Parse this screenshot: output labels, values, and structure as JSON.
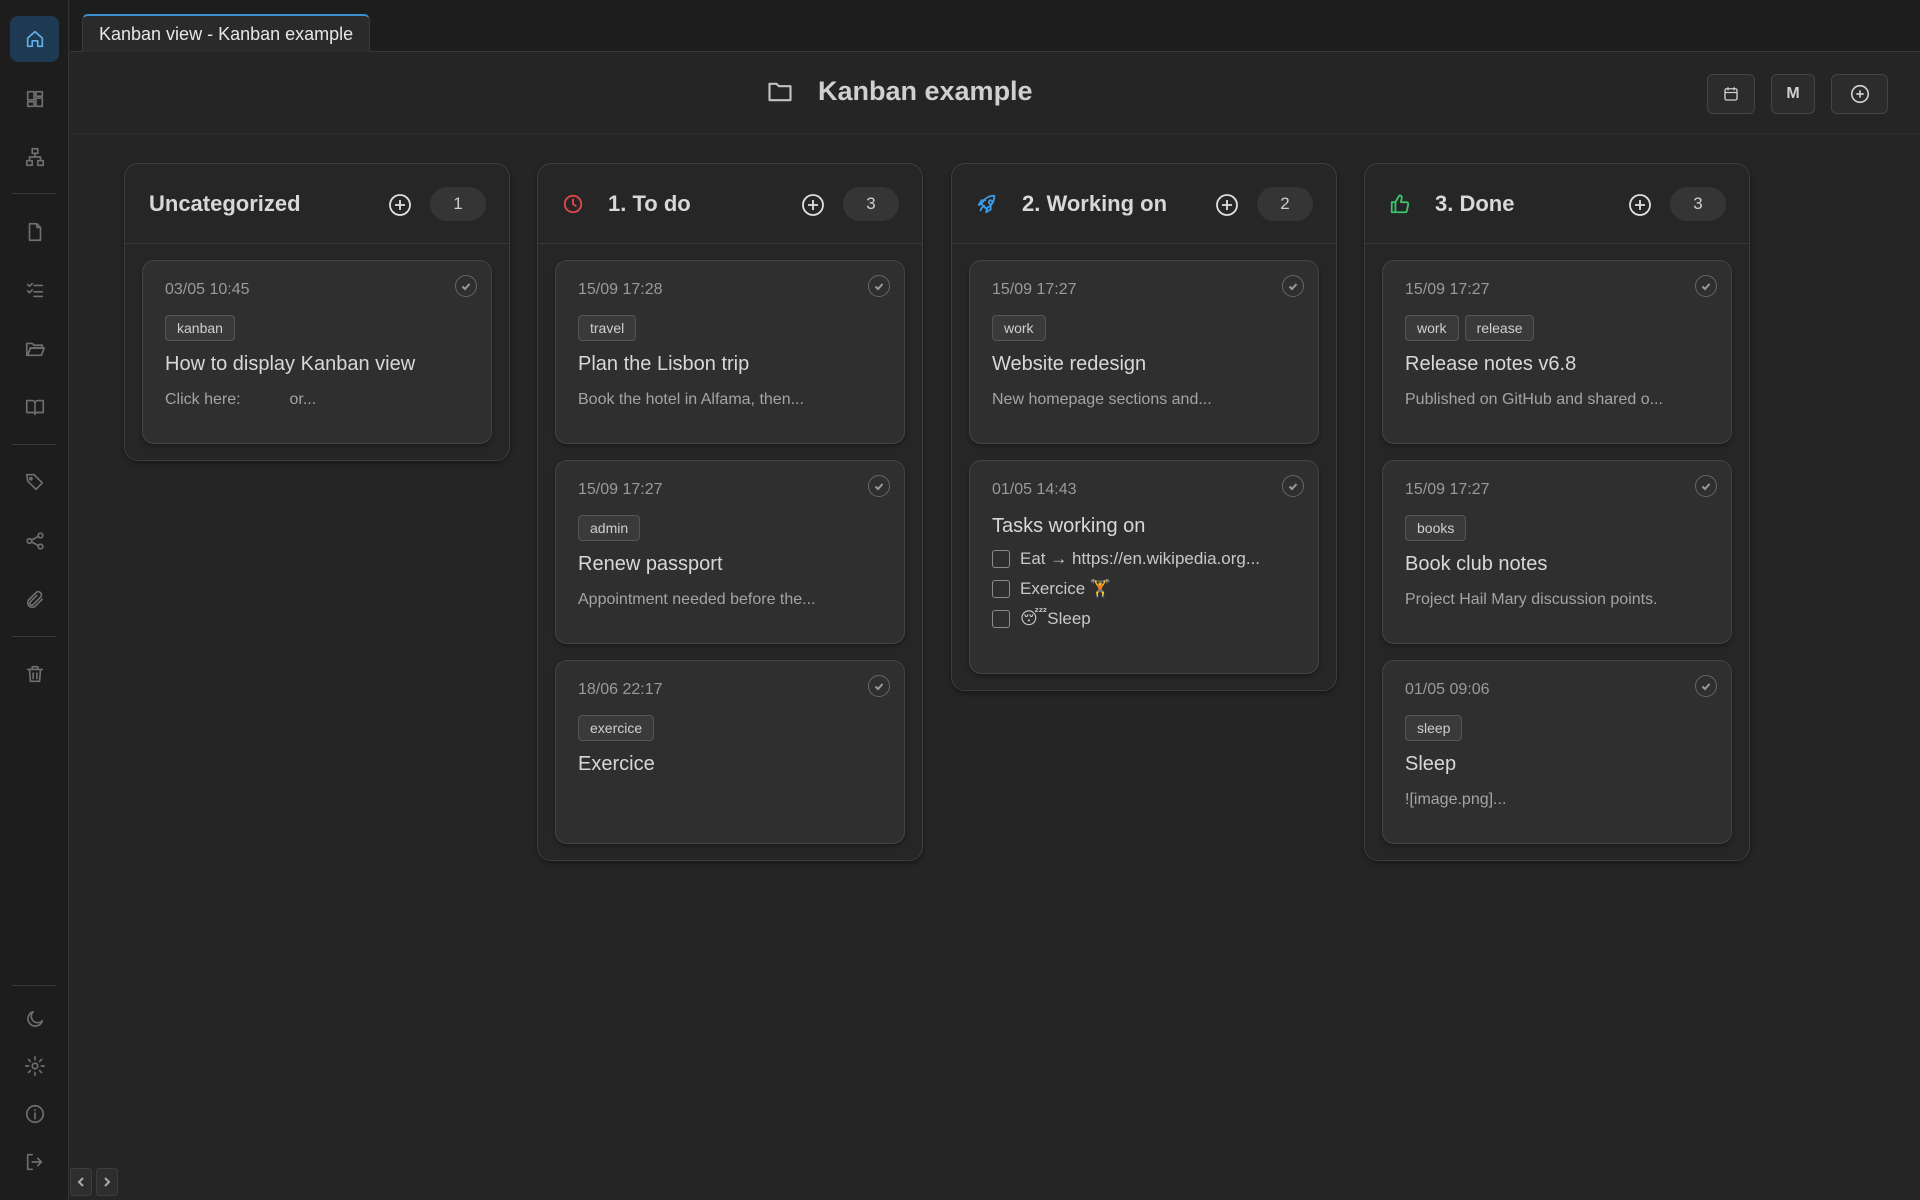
{
  "tab": {
    "label": "Kanban view - Kanban example"
  },
  "header": {
    "title": "Kanban example",
    "markdown_button": "M"
  },
  "colors": {
    "accent": "#3a8fd0",
    "todo_icon": "#e04848",
    "working_icon": "#3a9be8",
    "done_icon": "#3cc36a"
  },
  "columns": [
    {
      "title": "Uncategorized",
      "icon": "none",
      "count": "1",
      "cards": [
        {
          "date": "03/05 10:45",
          "tags": [
            "kanban"
          ],
          "title": "How to display Kanban view",
          "preview": "Click here:           or..."
        }
      ]
    },
    {
      "title": "1. To do",
      "icon": "clock-icon",
      "count": "3",
      "cards": [
        {
          "date": "15/09 17:28",
          "tags": [
            "travel"
          ],
          "title": "Plan the Lisbon trip",
          "preview": "Book the hotel in Alfama, then..."
        },
        {
          "date": "15/09 17:27",
          "tags": [
            "admin"
          ],
          "title": "Renew passport",
          "preview": "Appointment needed before the..."
        },
        {
          "date": "18/06 22:17",
          "tags": [
            "exercice"
          ],
          "title": "Exercice",
          "preview": ""
        }
      ]
    },
    {
      "title": "2. Working on",
      "icon": "rocket-icon",
      "count": "2",
      "cards": [
        {
          "date": "15/09 17:27",
          "tags": [
            "work"
          ],
          "title": "Website redesign",
          "preview": "New homepage sections and..."
        },
        {
          "date": "01/05 14:43",
          "tags": [],
          "title": "Tasks working on",
          "checklist": [
            "Eat → https://en.wikipedia.org...",
            "Exercice 🏋",
            "😴Sleep"
          ]
        }
      ]
    },
    {
      "title": "3. Done",
      "icon": "thumbs-up-icon",
      "count": "3",
      "cards": [
        {
          "date": "15/09 17:27",
          "tags": [
            "work",
            "release"
          ],
          "title": "Release notes v6.8",
          "preview": "Published on GitHub and shared o..."
        },
        {
          "date": "15/09 17:27",
          "tags": [
            "books"
          ],
          "title": "Book club notes",
          "preview": "Project Hail Mary discussion points."
        },
        {
          "date": "01/05 09:06",
          "tags": [
            "sleep"
          ],
          "title": "Sleep",
          "preview": "![image.png]..."
        }
      ]
    }
  ]
}
